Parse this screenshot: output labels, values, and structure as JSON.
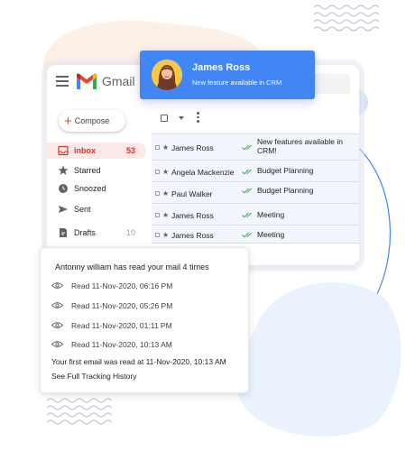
{
  "app": {
    "name": "Gmail"
  },
  "sidebar": {
    "compose_label": "Compose",
    "items": [
      {
        "label": "inbox",
        "count": "53",
        "icon": "inbox-icon"
      },
      {
        "label": "Starred",
        "count": "",
        "icon": "star-icon"
      },
      {
        "label": "Snoozed",
        "count": "",
        "icon": "clock-icon"
      },
      {
        "label": "Sent",
        "count": "",
        "icon": "send-icon"
      },
      {
        "label": "Drafts",
        "count": "10",
        "icon": "draft-icon"
      }
    ]
  },
  "mails": [
    {
      "sender": "James Ross",
      "subject": "New features available in CRM!"
    },
    {
      "sender": "Angela Mackenzie",
      "subject": "Budget Planning"
    },
    {
      "sender": "Paul Walker",
      "subject": "Budget Planning"
    },
    {
      "sender": "James Ross",
      "subject": "Meeting"
    },
    {
      "sender": "James Ross",
      "subject": "Meeting"
    }
  ],
  "notification": {
    "name": "James Ross",
    "message": "New feature available in CRM"
  },
  "tracking": {
    "title": "Antonny william has read your mail 4 times",
    "reads": [
      "Read 11-Nov-2020, 06:16 PM",
      "Read 11-Nov-2020, 05:26 PM",
      "Read 11-Nov-2020, 01:11 PM",
      "Read 11-Nov-2020, 10:13 AM"
    ],
    "first_read": "Your first email was read at 11-Nov-2020, 10:13 AM",
    "history_link": "See Full Tracking History"
  },
  "colors": {
    "accent_blue": "#4285f4",
    "inbox_red": "#d93025",
    "inbox_highlight": "#fce8e6",
    "read_tick_green": "#34a853"
  }
}
